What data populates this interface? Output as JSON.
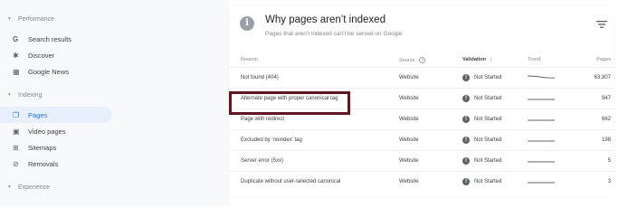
{
  "sidebar": {
    "sections": [
      {
        "label": "Performance",
        "items": [
          {
            "label": "Search results",
            "icon": "google-g-icon"
          },
          {
            "label": "Discover",
            "icon": "asterisk-icon"
          },
          {
            "label": "Google News",
            "icon": "news-icon"
          }
        ]
      },
      {
        "label": "Indexing",
        "items": [
          {
            "label": "Pages",
            "icon": "pages-icon",
            "active": true
          },
          {
            "label": "Video pages",
            "icon": "video-pages-icon"
          },
          {
            "label": "Sitemaps",
            "icon": "sitemap-icon"
          },
          {
            "label": "Removals",
            "icon": "removals-icon"
          }
        ]
      },
      {
        "label": "Experience",
        "items": []
      }
    ]
  },
  "panel": {
    "title": "Why pages aren’t indexed",
    "subtitle": "Pages that aren’t indexed can’t be served on Google",
    "columns": {
      "reason": "Reason",
      "source": "Source",
      "validation": "Validation",
      "trend": "Trend",
      "pages": "Pages"
    },
    "rows": [
      {
        "reason": "Not found (404)",
        "source": "Website",
        "validation": "Not Started",
        "pages": "63,807"
      },
      {
        "reason": "Alternate page with proper canonical tag",
        "source": "Website",
        "validation": "Not Started",
        "pages": "947"
      },
      {
        "reason": "Page with redirect",
        "source": "Website",
        "validation": "Not Started",
        "pages": "662"
      },
      {
        "reason": "Excluded by ‘noindex’ tag",
        "source": "Website",
        "validation": "Not Started",
        "pages": "198"
      },
      {
        "reason": "Server error (5xx)",
        "source": "Website",
        "validation": "Not Started",
        "pages": "5"
      },
      {
        "reason": "Duplicate without user-selected canonical",
        "source": "Website",
        "validation": "Not Started",
        "pages": "3"
      }
    ]
  },
  "colors": {
    "accent": "#1a73e8",
    "active_bg": "#e8f0fe",
    "highlight": "#6e0f1a"
  }
}
